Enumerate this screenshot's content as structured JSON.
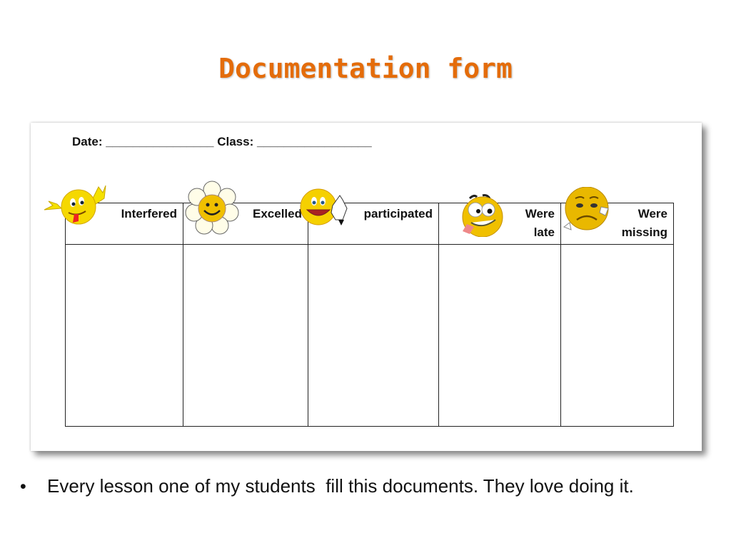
{
  "slide_title": "Documentation form",
  "form": {
    "date_line": "Date: ________________ Class: _________________",
    "columns": [
      {
        "label": "Interfered",
        "icon": "tongue-waving-smiley-icon"
      },
      {
        "label": "Excelled",
        "icon": "flower-smiley-icon"
      },
      {
        "label": "participated",
        "icon": "thumbs-up-smiley-icon"
      },
      {
        "label": "Were late",
        "line1": "Were",
        "line2": "late",
        "icon": "crazy-smiley-icon"
      },
      {
        "label": "Were missing",
        "line1": "Were",
        "line2": "missing",
        "icon": "sad-smiley-icon"
      }
    ]
  },
  "bullet": "Every lesson one of my students  fill this documents. They love doing it.",
  "colors": {
    "title": "#e46c0a",
    "emoji": "#f5d000"
  }
}
